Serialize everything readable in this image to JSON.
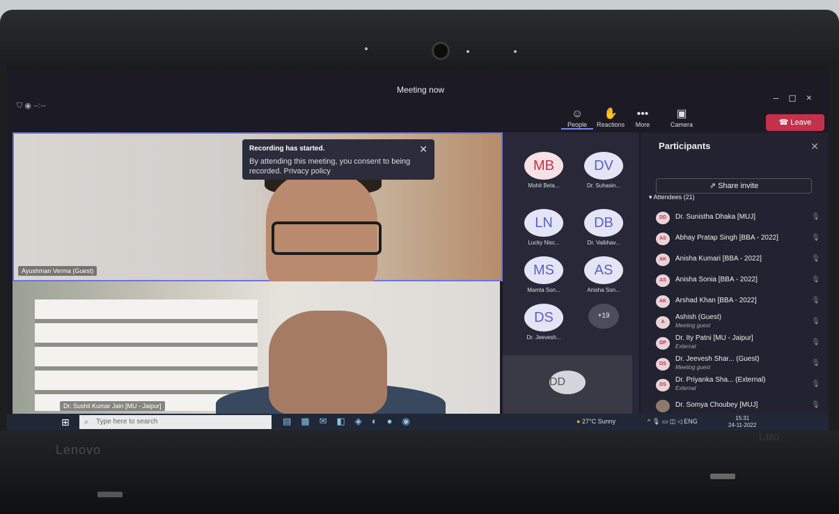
{
  "window": {
    "title": "Meeting now",
    "timer": "--:--"
  },
  "toolbar": {
    "people": "People",
    "reactions": "Reactions",
    "more": "More",
    "camera": "Camera",
    "leave": "Leave"
  },
  "toast": {
    "title": "Recording has started.",
    "body": "By attending this meeting, you consent to being recorded. Privacy policy"
  },
  "videos": {
    "main_name": "Ayushman Verma (Guest)",
    "second_name": "Dr. Sushil Kumar Jain [MU - Jaipur]"
  },
  "gallery": [
    {
      "initials": "MB",
      "name": "Mohit Beta...",
      "style": "pink"
    },
    {
      "initials": "DV",
      "name": "Dr. Suhasin...",
      "style": "blue"
    },
    {
      "initials": "LN",
      "name": "Lucky Nisc...",
      "style": "blue"
    },
    {
      "initials": "DB",
      "name": "Dr. Vaibhav...",
      "style": "blue"
    },
    {
      "initials": "MS",
      "name": "Mamta Son...",
      "style": "blue"
    },
    {
      "initials": "AS",
      "name": "Anisha Son...",
      "style": "blue"
    },
    {
      "initials": "DS",
      "name": "Dr. Jeevesh...",
      "style": "blue"
    },
    {
      "initials": "+19",
      "name": "",
      "style": "more"
    }
  ],
  "bottom_tile": {
    "initials": "DD"
  },
  "panel": {
    "title": "Participants",
    "share": "Share invite",
    "attendees": "Attendees (21)",
    "participants": [
      {
        "initials": "DD",
        "name": "Dr. Sunistha Dhaka [MUJ]",
        "sub": ""
      },
      {
        "initials": "AS",
        "name": "Abhay Pratap Singh [BBA - 2022]",
        "sub": ""
      },
      {
        "initials": "AK",
        "name": "Anisha Kumari [BBA - 2022]",
        "sub": ""
      },
      {
        "initials": "AS",
        "name": "Anisha Sonia [BBA - 2022]",
        "sub": ""
      },
      {
        "initials": "AK",
        "name": "Arshad Khan [BBA - 2022]",
        "sub": ""
      },
      {
        "initials": "A",
        "name": "Ashish (Guest)",
        "sub": "Meeting guest"
      },
      {
        "initials": "DP",
        "name": "Dr. Ity Patni [MU - Jaipur]",
        "sub": "External"
      },
      {
        "initials": "DS",
        "name": "Dr. Jeevesh Shar... (Guest)",
        "sub": "Meeting guest"
      },
      {
        "initials": "DS",
        "name": "Dr. Priyanka Sha... (External)",
        "sub": "External"
      },
      {
        "initials": "",
        "name": "Dr. Somya Choubey [MUJ]",
        "sub": ""
      }
    ]
  },
  "taskbar": {
    "search_placeholder": "Type here to search",
    "weather": "27°C Sunny",
    "lang": "ENG",
    "time": "15:31",
    "date": "24-11-2022"
  },
  "device": {
    "brand": "Lenovo",
    "model": "L480"
  }
}
